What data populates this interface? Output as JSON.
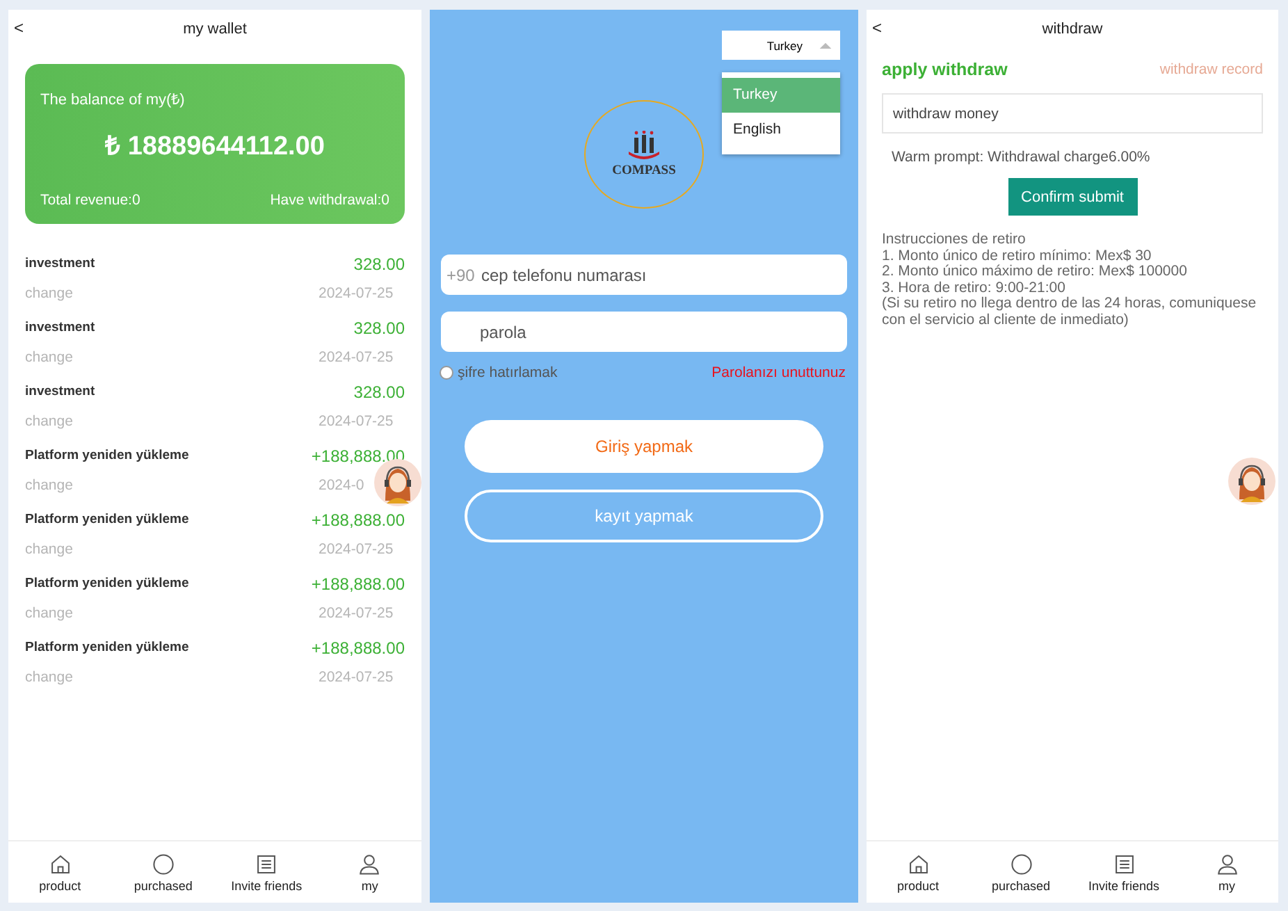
{
  "wallet": {
    "title": "my wallet",
    "back": "<",
    "card": {
      "label": "The balance of my(₺)",
      "balance": "₺ 18889644112.00",
      "revenue": "Total revenue:0",
      "withdrawal": "Have withdrawal:0"
    },
    "records": [
      {
        "title": "investment",
        "amount": "328.00",
        "type": "change",
        "date": "2024-07-25"
      },
      {
        "title": "investment",
        "amount": "328.00",
        "type": "change",
        "date": "2024-07-25"
      },
      {
        "title": "investment",
        "amount": "328.00",
        "type": "change",
        "date": "2024-07-25"
      },
      {
        "title": "Platform yeniden yükleme",
        "amount": "+188,888.00",
        "type": "change",
        "date": "2024-0"
      },
      {
        "title": "Platform yeniden yükleme",
        "amount": "+188,888.00",
        "type": "change",
        "date": "2024-07-25"
      },
      {
        "title": "Platform yeniden yükleme",
        "amount": "+188,888.00",
        "type": "change",
        "date": "2024-07-25"
      },
      {
        "title": "Platform yeniden yükleme",
        "amount": "+188,888.00",
        "type": "change",
        "date": "2024-07-25"
      }
    ],
    "nav": [
      "product",
      "purchased",
      "Invite friends",
      "my"
    ]
  },
  "login": {
    "language": {
      "value": "Turkey",
      "options": [
        {
          "label": "Turkey",
          "selected": true
        },
        {
          "label": "English",
          "selected": false
        }
      ]
    },
    "logo": "COMPASS",
    "phone": {
      "prefix": "+90",
      "placeholder": "cep telefonu numarası"
    },
    "password": {
      "placeholder": "parola"
    },
    "remember": {
      "label": "şifre hatırlamak",
      "checked": false
    },
    "forgot": "Parolanızı unuttunuz",
    "login_button": "Giriş yapmak",
    "register_button": "kayıt yapmak"
  },
  "withdraw": {
    "title": "withdraw",
    "back": "<",
    "heading": "apply withdraw",
    "record_link": "withdraw record",
    "amount": {
      "placeholder": "withdraw money"
    },
    "prompt": "Warm prompt:  Withdrawal charge6.00%",
    "submit": "Confirm submit",
    "instructions": [
      "Instrucciones de retiro",
      "1. Monto único de retiro mínimo: Mex$ 30",
      "2. Monto único máximo de retiro: Mex$ 100000",
      "3. Hora de retiro: 9:00-21:00",
      "(Si su retiro no llega dentro de las 24 horas, comuniquese con el servicio al cliente de inmediato)"
    ],
    "nav": [
      "product",
      "purchased",
      "Invite friends",
      "my"
    ]
  }
}
